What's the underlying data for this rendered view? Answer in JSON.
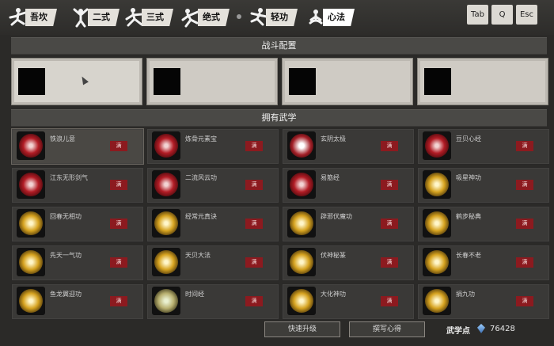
{
  "tabs": [
    {
      "label": "吾坎",
      "icon": "kick-stance-icon"
    },
    {
      "label": "二式",
      "icon": "arms-raised-stance-icon"
    },
    {
      "label": "三式",
      "icon": "lunge-stance-icon"
    },
    {
      "label": "绝式",
      "icon": "fighter-stance-icon"
    },
    {
      "label": "轻功",
      "icon": "leap-stance-icon"
    },
    {
      "label": "心法",
      "icon": "meditation-icon",
      "active": true
    }
  ],
  "keys": {
    "tab": "Tab",
    "q": "Q",
    "esc": "Esc"
  },
  "sections": {
    "loadout": "战斗配置",
    "owned": "拥有武学"
  },
  "loadout_slots": 4,
  "skills": [
    {
      "name": "铁浪儿意",
      "badge": "满",
      "icon": "red-swirl-icon",
      "tone": "red"
    },
    {
      "name": "炼骨元素宝",
      "badge": "满",
      "icon": "red-flame-icon",
      "tone": "red"
    },
    {
      "name": "玄阴太极",
      "badge": "满",
      "icon": "yin-yang-icon",
      "tone": "yy"
    },
    {
      "name": "豆贝心经",
      "badge": "满",
      "icon": "red-dragon-icon",
      "tone": "red"
    },
    {
      "name": "江东无形剑气",
      "badge": "满",
      "icon": "red-fire-fist-icon",
      "tone": "red"
    },
    {
      "name": "二流风云功",
      "badge": "满",
      "icon": "red-warrior-icon",
      "tone": "red"
    },
    {
      "name": "易筋经",
      "badge": "满",
      "icon": "red-lotus-icon",
      "tone": "red"
    },
    {
      "name": "吸星神功",
      "badge": "满",
      "icon": "gold-beast-icon",
      "tone": "gold"
    },
    {
      "name": "回春无相功",
      "badge": "满",
      "icon": "gold-fountain-icon",
      "tone": "gold"
    },
    {
      "name": "经常元真诀",
      "badge": "满",
      "icon": "gold-scroll-icon",
      "tone": "gold"
    },
    {
      "name": "辟邪伏魔功",
      "badge": "满",
      "icon": "gold-dragon-icon",
      "tone": "gold"
    },
    {
      "name": "鹤步秘典",
      "badge": "满",
      "icon": "gold-crane-icon",
      "tone": "gold"
    },
    {
      "name": "先天一气功",
      "badge": "满",
      "icon": "gold-sparkle-icon",
      "tone": "gold"
    },
    {
      "name": "天贝大法",
      "badge": "满",
      "icon": "gold-cloud-icon",
      "tone": "gold"
    },
    {
      "name": "伏神秘篆",
      "badge": "满",
      "icon": "gold-lion-icon",
      "tone": "gold"
    },
    {
      "name": "长春不老",
      "badge": "满",
      "icon": "gold-circle-icon",
      "tone": "gold"
    },
    {
      "name": "鱼龙翼迎功",
      "badge": "满",
      "icon": "gold-fish-icon",
      "tone": "gold"
    },
    {
      "name": "时间经",
      "badge": "满",
      "icon": "pale-bell-icon",
      "tone": "gold2"
    },
    {
      "name": "大化神功",
      "badge": "满",
      "icon": "gold-wind-icon",
      "tone": "gold"
    },
    {
      "name": "捐九功",
      "badge": "满",
      "icon": "gold-lotus-icon",
      "tone": "gold"
    }
  ],
  "buttons": {
    "quick_upgrade": "快速升级",
    "write_manual": "撰写心得"
  },
  "points": {
    "label": "武学点",
    "value": "76428",
    "icon": "blue-gem-icon"
  },
  "colors": {
    "badge": "#8c1a1f",
    "panel": "#3a3937",
    "slot": "#cfcbc4"
  }
}
